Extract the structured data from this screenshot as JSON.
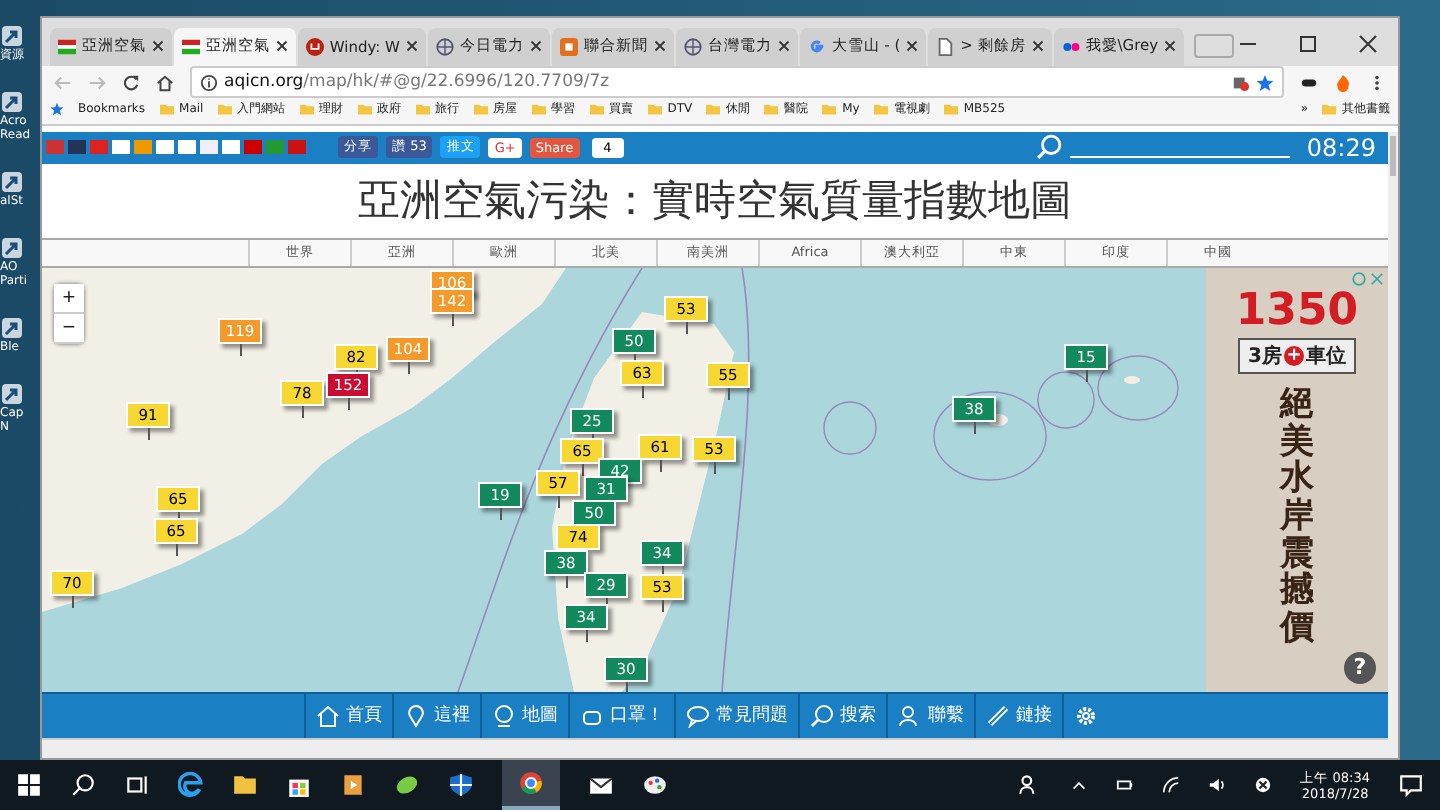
{
  "desktop": {
    "icons": [
      {
        "lines": [
          "資源"
        ]
      },
      {
        "lines": [
          "Acro",
          "Read"
        ]
      },
      {
        "lines": [
          "alSt"
        ]
      },
      {
        "lines": [
          "AO",
          "Parti"
        ]
      },
      {
        "lines": [
          "Ble"
        ]
      },
      {
        "lines": [
          "Cap",
          "N"
        ]
      }
    ]
  },
  "tabs": [
    {
      "title": "亞洲空氣",
      "kind": "flag",
      "selected": false
    },
    {
      "title": "亞洲空氣",
      "kind": "flag",
      "selected": true
    },
    {
      "title": "Windy: W",
      "kind": "windy",
      "selected": false
    },
    {
      "title": "今日電力",
      "kind": "globe",
      "selected": false
    },
    {
      "title": "聯合新聞",
      "kind": "news",
      "selected": false
    },
    {
      "title": "台灣電力",
      "kind": "globe",
      "selected": false
    },
    {
      "title": "大雪山 - (",
      "kind": "google",
      "selected": false
    },
    {
      "title": "> 剩餘房",
      "kind": "doc",
      "selected": false
    },
    {
      "title": "我愛\\Grey",
      "kind": "flickr",
      "selected": false
    }
  ],
  "address": {
    "host": "aqicn.org",
    "path": "/map/hk/#@g/22.6996/120.7709/7z"
  },
  "bookmarks": {
    "title": "Bookmarks",
    "folders": [
      "Mail",
      "入門網站",
      "理財",
      "政府",
      "旅行",
      "房屋",
      "學習",
      "買賣",
      "DTV",
      "休閒",
      "醫院",
      "My",
      "電視劇",
      "MB525"
    ],
    "more": "»",
    "other": "其他書籤"
  },
  "site": {
    "social": [
      {
        "kind": "facebook",
        "label": "分享"
      },
      {
        "kind": "like",
        "label": "讚 53"
      },
      {
        "kind": "twitter",
        "label": "推文"
      },
      {
        "kind": "gplus",
        "label": "G+"
      },
      {
        "kind": "share",
        "label": "Share"
      }
    ],
    "share_count": "4",
    "clock": "08:29",
    "title": "亞洲空氣污染：實時空氣質量指數地圖",
    "regions": [
      "世界",
      "亞洲",
      "歐洲",
      "北美",
      "南美洲",
      "Africa",
      "澳大利亞",
      "中東",
      "印度",
      "中國"
    ],
    "zoom": [
      "+",
      "−"
    ],
    "markers": [
      {
        "value": "106",
        "color": "#f39a2b"
      },
      {
        "value": "142",
        "color": "#f39a2b"
      },
      {
        "value": "119",
        "color": "#f39a2b"
      },
      {
        "value": "82",
        "color": "#f7d732"
      },
      {
        "value": "104",
        "color": "#f39a2b"
      },
      {
        "value": "78",
        "color": "#f7d732"
      },
      {
        "value": "152",
        "color": "#cc0b33"
      },
      {
        "value": "91",
        "color": "#f7d732"
      },
      {
        "value": "65",
        "color": "#f7d732"
      },
      {
        "value": "65",
        "color": "#f7d732"
      },
      {
        "value": "70",
        "color": "#f7d732"
      },
      {
        "value": "19",
        "color": "#138a5e"
      },
      {
        "value": "53",
        "color": "#f7d732"
      },
      {
        "value": "50",
        "color": "#138a5e"
      },
      {
        "value": "63",
        "color": "#f7d732"
      },
      {
        "value": "55",
        "color": "#f7d732"
      },
      {
        "value": "25",
        "color": "#138a5e"
      },
      {
        "value": "65",
        "color": "#f7d732"
      },
      {
        "value": "42",
        "color": "#138a5e"
      },
      {
        "value": "61",
        "color": "#f7d732"
      },
      {
        "value": "53",
        "color": "#f7d732"
      },
      {
        "value": "57",
        "color": "#f7d732"
      },
      {
        "value": "31",
        "color": "#138a5e"
      },
      {
        "value": "50",
        "color": "#138a5e"
      },
      {
        "value": "74",
        "color": "#f7d732"
      },
      {
        "value": "38",
        "color": "#138a5e"
      },
      {
        "value": "34",
        "color": "#138a5e"
      },
      {
        "value": "29",
        "color": "#138a5e"
      },
      {
        "value": "53",
        "color": "#f7d732"
      },
      {
        "value": "34",
        "color": "#138a5e"
      },
      {
        "value": "30",
        "color": "#138a5e"
      },
      {
        "value": "38",
        "color": "#138a5e"
      },
      {
        "value": "15",
        "color": "#138a5e"
      }
    ],
    "ad": {
      "price": "1350",
      "rooms": "3房",
      "plus": "+",
      "parking": "車位",
      "slogan": "絕美水岸震撼價",
      "help": "?"
    },
    "nav": [
      {
        "kind": "home",
        "label": "首頁"
      },
      {
        "kind": "pin",
        "label": "這裡"
      },
      {
        "kind": "globe",
        "label": "地圖"
      },
      {
        "kind": "mask",
        "label": "口罩！"
      },
      {
        "kind": "faq",
        "label": "常見問題"
      },
      {
        "kind": "search",
        "label": "搜索"
      },
      {
        "kind": "contact",
        "label": "聯繫"
      },
      {
        "kind": "link",
        "label": "鏈接"
      },
      {
        "kind": "settings"
      }
    ]
  },
  "taskbar": {
    "time": "上午 08:34",
    "date": "2018/7/28"
  }
}
